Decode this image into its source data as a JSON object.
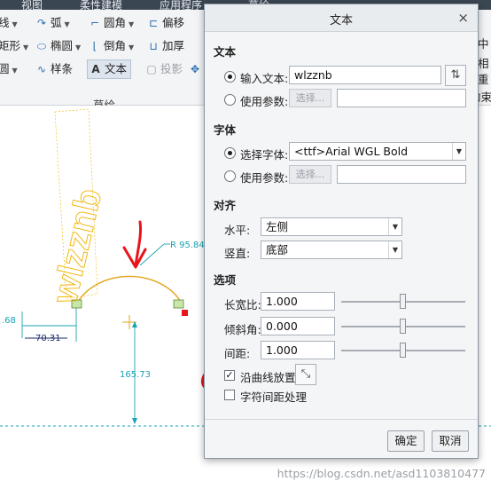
{
  "ribbon": {
    "tabs": [
      "视图",
      "柔性建模",
      "应用程序",
      "草绘"
    ],
    "row1": [
      {
        "icon": "line-icon",
        "label": "线",
        "caret": true
      },
      {
        "icon": "arc-icon",
        "label": "弧",
        "caret": true
      },
      {
        "icon": "fillet-icon",
        "label": "圆角",
        "caret": true
      },
      {
        "icon": "offset-icon",
        "label": "偏移"
      }
    ],
    "row2": [
      {
        "icon": "rectangle-icon",
        "label": "矩形",
        "caret": true
      },
      {
        "icon": "ellipse-icon",
        "label": "椭圆",
        "caret": true
      },
      {
        "icon": "chamfer-icon",
        "label": "倒角",
        "caret": true
      },
      {
        "icon": "thicken-icon",
        "label": "加厚"
      }
    ],
    "row3": [
      {
        "icon": "circle-icon",
        "label": "圆",
        "caret": true
      },
      {
        "icon": "spline-icon",
        "label": "样条"
      },
      {
        "icon": "text-icon",
        "label": "文本"
      },
      {
        "icon": "project-icon",
        "label": "投影"
      }
    ],
    "group_label": "草绘",
    "right_labels": [
      "中",
      "相",
      "中",
      "重",
      "约束"
    ]
  },
  "canvas": {
    "sketch_text": "wlzznb",
    "dims": {
      "radius": "R 95.84",
      "vertical": "165.73",
      "horizontal": "70.31",
      "left": ".68"
    },
    "watermark": "https://blog.csdn.net/asd1103810477"
  },
  "dialog": {
    "title": "文本",
    "close": "×",
    "sections": {
      "text": "文本",
      "font": "字体",
      "align": "对齐",
      "options": "选项"
    },
    "text": {
      "input_label": "输入文本:",
      "input_value": "wlzznb",
      "param_label": "使用参数:",
      "select_btn": "选择..."
    },
    "font": {
      "select_label": "选择字体:",
      "font_value": "<ttf>Arial WGL Bold",
      "param_label": "使用参数:",
      "select_btn": "选择..."
    },
    "align": {
      "h_label": "水平:",
      "h_value": "左侧",
      "v_label": "竖直:",
      "v_value": "底部"
    },
    "options": {
      "aspect_label": "长宽比:",
      "aspect_value": "1.000",
      "aspect_level": 0.5,
      "slant_label": "倾斜角:",
      "slant_value": "0.000",
      "slant_level": 0.5,
      "spacing_label": "间距:",
      "spacing_value": "1.000",
      "spacing_level": 0.5,
      "along_curve_label": "沿曲线放置",
      "along_curve_checked": true,
      "kerning_label": "字符间距处理",
      "kerning_checked": false
    },
    "ok": "确定",
    "cancel": "取消"
  },
  "colors": {
    "sketch_text": "#f0b400",
    "arc": "#e3a317",
    "dimension": "#19a3b3",
    "annotation": "#e8141c",
    "ribbon_accent": "#2f6fb0"
  }
}
